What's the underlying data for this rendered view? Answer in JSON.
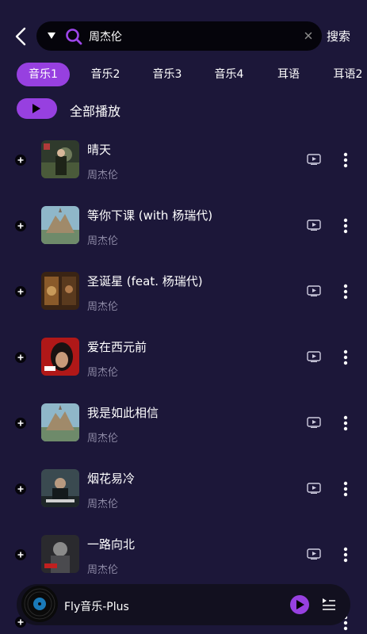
{
  "search": {
    "value": "周杰伦",
    "button_label": "搜索"
  },
  "tabs": [
    "音乐1",
    "音乐2",
    "音乐3",
    "音乐4",
    "耳语",
    "耳语2"
  ],
  "active_tab": 0,
  "play_all_label": "全部播放",
  "songs": [
    {
      "title": "晴天",
      "artist": "周杰伦"
    },
    {
      "title": "等你下课 (with 杨瑞代)",
      "artist": "周杰伦"
    },
    {
      "title": "圣诞星 (feat. 杨瑞代)",
      "artist": "周杰伦"
    },
    {
      "title": "爱在西元前",
      "artist": "周杰伦"
    },
    {
      "title": "我是如此相信",
      "artist": "周杰伦"
    },
    {
      "title": "烟花易冷",
      "artist": "周杰伦"
    },
    {
      "title": "一路向北",
      "artist": "周杰伦"
    }
  ],
  "player": {
    "title": "Fly音乐-Plus"
  },
  "icons": {
    "back": "back-arrow-icon",
    "dropdown": "triangle-down-icon",
    "search": "search-icon",
    "clear": "close-icon",
    "play": "play-icon",
    "add": "plus-icon",
    "mv": "video-icon",
    "more": "more-vertical-icon",
    "disc": "vinyl-disc-icon",
    "playlist": "playlist-icon"
  },
  "colors": {
    "background": "#1c1739",
    "accent": "#9740e0",
    "search_bg": "#05040b",
    "secondary_text": "#8c88a4",
    "player_bg": "#12101f"
  }
}
